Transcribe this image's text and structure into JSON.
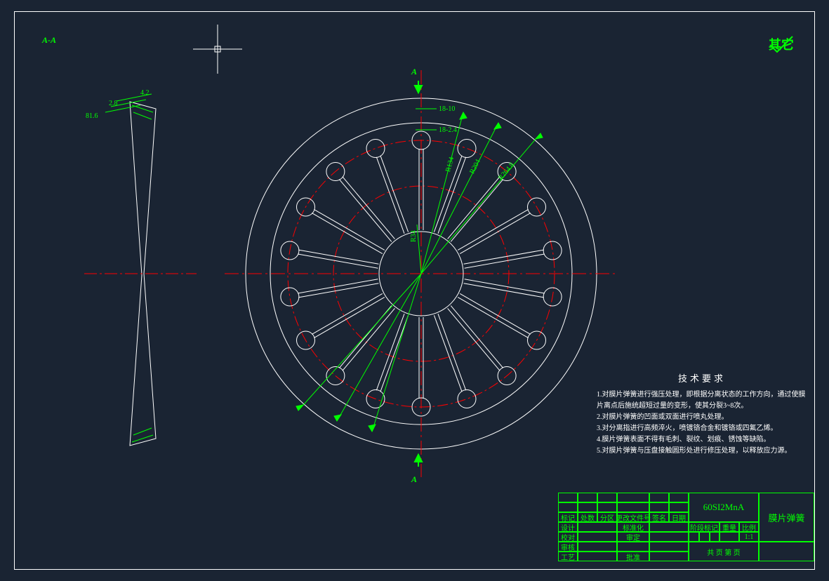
{
  "section_label": "A-A",
  "arrow_top": "A",
  "arrow_bottom": "A",
  "other_label": "其它",
  "dims": {
    "d1": "18-10",
    "d2": "18-2.4",
    "r1": "R134",
    "r2": "R204",
    "r3": "R264.8",
    "rinner": "R34",
    "side1": "81.6",
    "side2": "2.8",
    "side3": "4.2"
  },
  "requirements": {
    "title": "技术要求",
    "lines": [
      "1.对膜片弹簧进行强压处理，即根据分离状态的工作方向，通过使膜片离点后施统超短过量的变形，使其分裂3~8次。",
      "2.对膜片弹簧的凹面或双面进行喷丸处理。",
      "3.对分离指进行高频淬火，喷镀铬合金和镀铬或四氟乙烯。",
      "4.膜片弹簧表面不得有毛刺、裂纹、划痕、锈蚀等缺陷。",
      "5.对膜片弹簧与压盘接触圆形处进行修压处理，以释放应力源。"
    ]
  },
  "titleblock": {
    "material": "60SI2MnA",
    "partname": "膜片弹簧",
    "scale": "1:1",
    "rows": {
      "h1": "标记",
      "h2": "处数",
      "h3": "分区",
      "h4": "更改文件号",
      "h5": "签名",
      "h6": "日期",
      "r2a": "设计",
      "r2b": "标准化",
      "r3a": "校对",
      "r3b": "审定",
      "r4a": "审核",
      "r5a": "工艺",
      "r5b": "批准",
      "stage": "阶段标记",
      "weight": "重量",
      "scalelabel": "比例",
      "bottom": "共   页   第   页"
    }
  },
  "chart_data": {
    "type": "engineering-drawing",
    "views": [
      "section A-A (side profile)",
      "front view (face)"
    ],
    "finger_count": 18,
    "radii_mm": {
      "outer_contact": 264.8,
      "mid": 204,
      "inner_ring": 134,
      "hub": 34
    },
    "slot_width_mm": 2.4,
    "hole_dia_hint_mm": 10,
    "side_dims": {
      "angle_or_len_1": 81.6,
      "thk1": 2.8,
      "thk2": 4.2
    },
    "material": "60SI2MnA"
  }
}
